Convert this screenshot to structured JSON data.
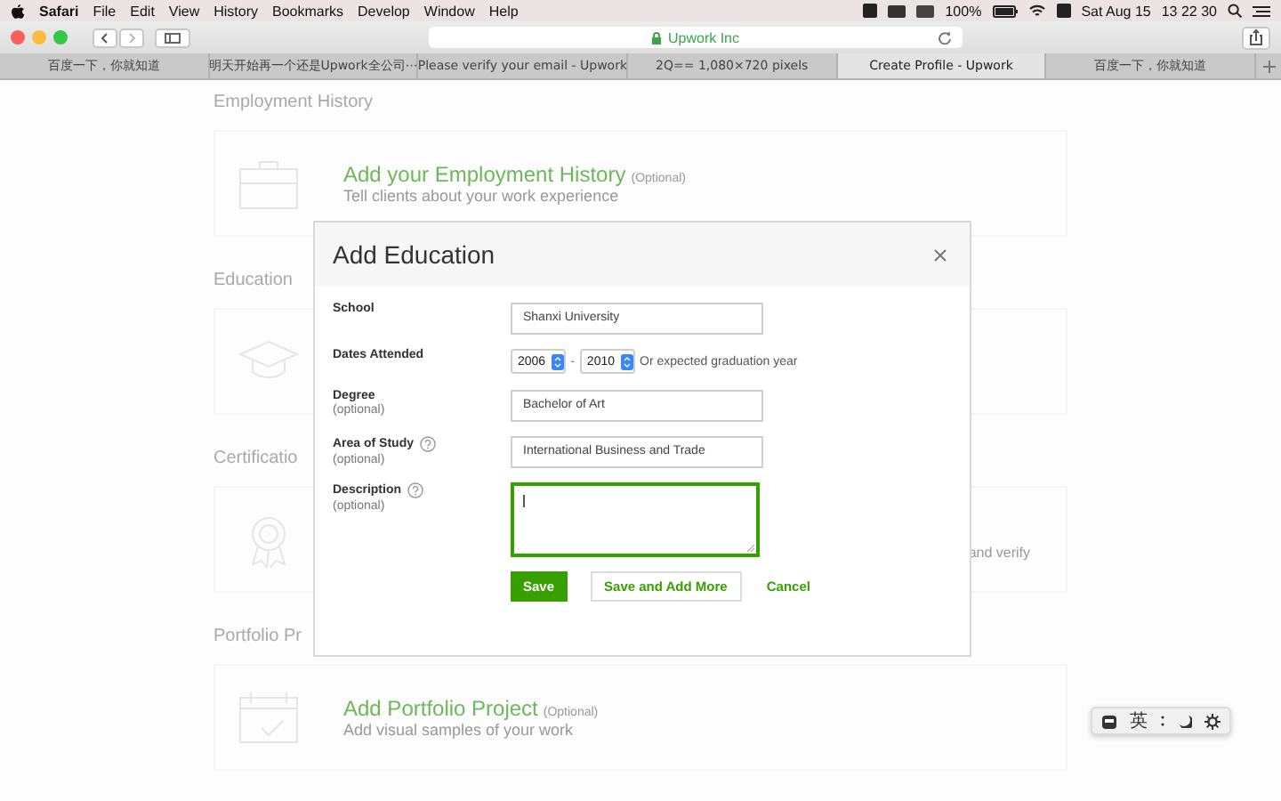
{
  "menubar": {
    "app": "Safari",
    "items": [
      "File",
      "Edit",
      "View",
      "History",
      "Bookmarks",
      "Develop",
      "Window",
      "Help"
    ],
    "battery": "100%",
    "date": "Sat Aug 15",
    "time": "13 22 30"
  },
  "toolbar": {
    "address": "Upwork Inc",
    "secure": true
  },
  "tabs": [
    {
      "label": "百度一下，你就知道",
      "selected": false
    },
    {
      "label": "明天开始再一个还是Upwork全公司⋯",
      "selected": false
    },
    {
      "label": "Please verify your email - Upwork",
      "selected": false
    },
    {
      "label": "2Q== 1,080×720 pixels",
      "selected": false
    },
    {
      "label": "Create Profile - Upwork",
      "selected": true
    },
    {
      "label": "百度一下，你就知道",
      "selected": false
    }
  ],
  "background": {
    "sections": [
      {
        "heading": "Employment History",
        "kind": "briefcase",
        "title": "Add your Employment History",
        "optional": "(Optional)",
        "subtitle": "Tell clients about your work experience"
      },
      {
        "heading": "Education",
        "kind": "cap"
      },
      {
        "heading": "Certificatio",
        "kind": "award",
        "side_text": "and verify"
      },
      {
        "heading": "Portfolio Pr",
        "kind": "portfolio",
        "title": "Add Portfolio Project",
        "optional": "(Optional)",
        "subtitle": "Add visual samples of your work"
      }
    ]
  },
  "dialog": {
    "title": "Add Education",
    "fields": [
      {
        "kind": "text",
        "label": "School",
        "value": "Shanxi University"
      },
      {
        "kind": "dates",
        "label": "Dates Attended",
        "from": "2006",
        "separator": "-",
        "to": "2010",
        "note": "Or expected graduation year"
      },
      {
        "kind": "text",
        "label": "Degree",
        "optional": "(optional)",
        "value": "Bachelor of Art"
      },
      {
        "kind": "text",
        "label": "Area of Study",
        "help": true,
        "optional": "(optional)",
        "value": "International Business and Trade"
      },
      {
        "kind": "textarea",
        "label": "Description",
        "help": true,
        "optional": "(optional)",
        "focused": true
      }
    ],
    "buttons": [
      {
        "label": "Save",
        "kind": "primary"
      },
      {
        "label": "Save and Add More",
        "kind": "secondary"
      },
      {
        "label": "Cancel",
        "kind": "link"
      }
    ]
  },
  "ime_bar": {
    "label": "英"
  }
}
